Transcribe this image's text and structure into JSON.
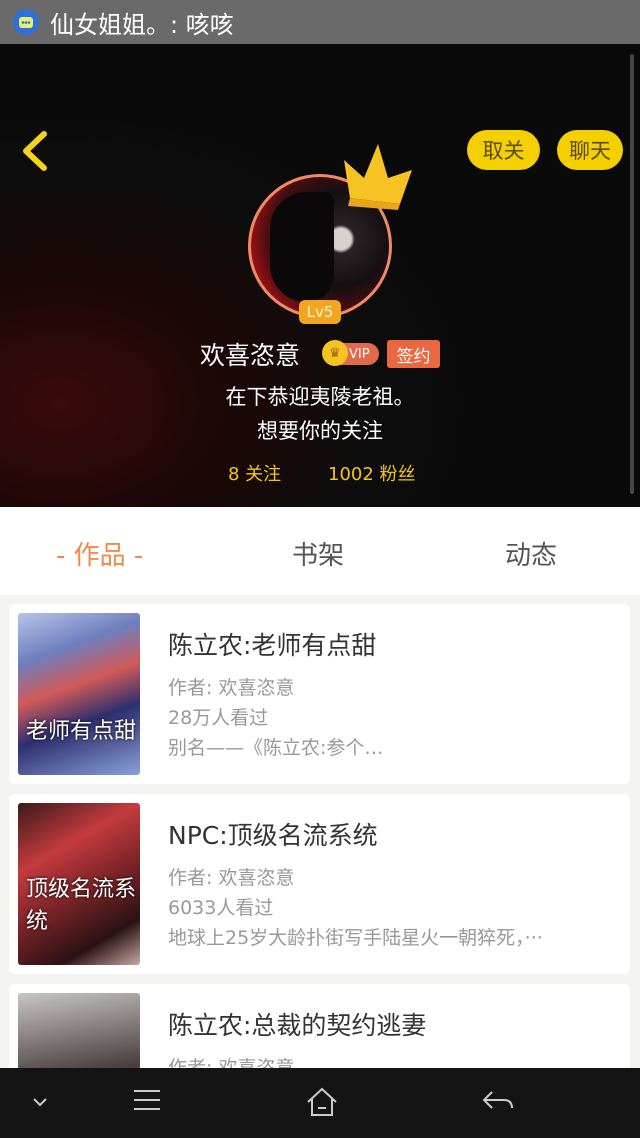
{
  "statusbar": {
    "notification_text": "仙女姐姐。: 咳咳"
  },
  "header": {
    "unfollow_label": "取关",
    "chat_label": "聊天",
    "level": "Lv5",
    "username": "欢喜恣意",
    "vip_label": "VIP",
    "signed_label": "签约",
    "bio_line1": "在下恭迎夷陵老祖。",
    "bio_line2": "想要你的关注",
    "following": "8 关注",
    "fans": "1002 粉丝"
  },
  "tabs": {
    "works": "- 作品 -",
    "bookshelf": "书架",
    "moments": "动态"
  },
  "books": [
    {
      "title": "陈立农:老师有点甜",
      "author": "作者: 欢喜恣意",
      "views": "28万人看过",
      "desc": "别名——《陈立农:参个…",
      "cover_text": "老师有点甜"
    },
    {
      "title": "NPC:顶级名流系统",
      "author": "作者: 欢喜恣意",
      "views": "6033人看过",
      "desc": "地球上25岁大龄扑街写手陆星火一朝猝死，···",
      "cover_text": "顶级名流系统"
    },
    {
      "title": "陈立农:总裁的契约逃妻",
      "author": "作者: 欢喜恣意"
    }
  ]
}
